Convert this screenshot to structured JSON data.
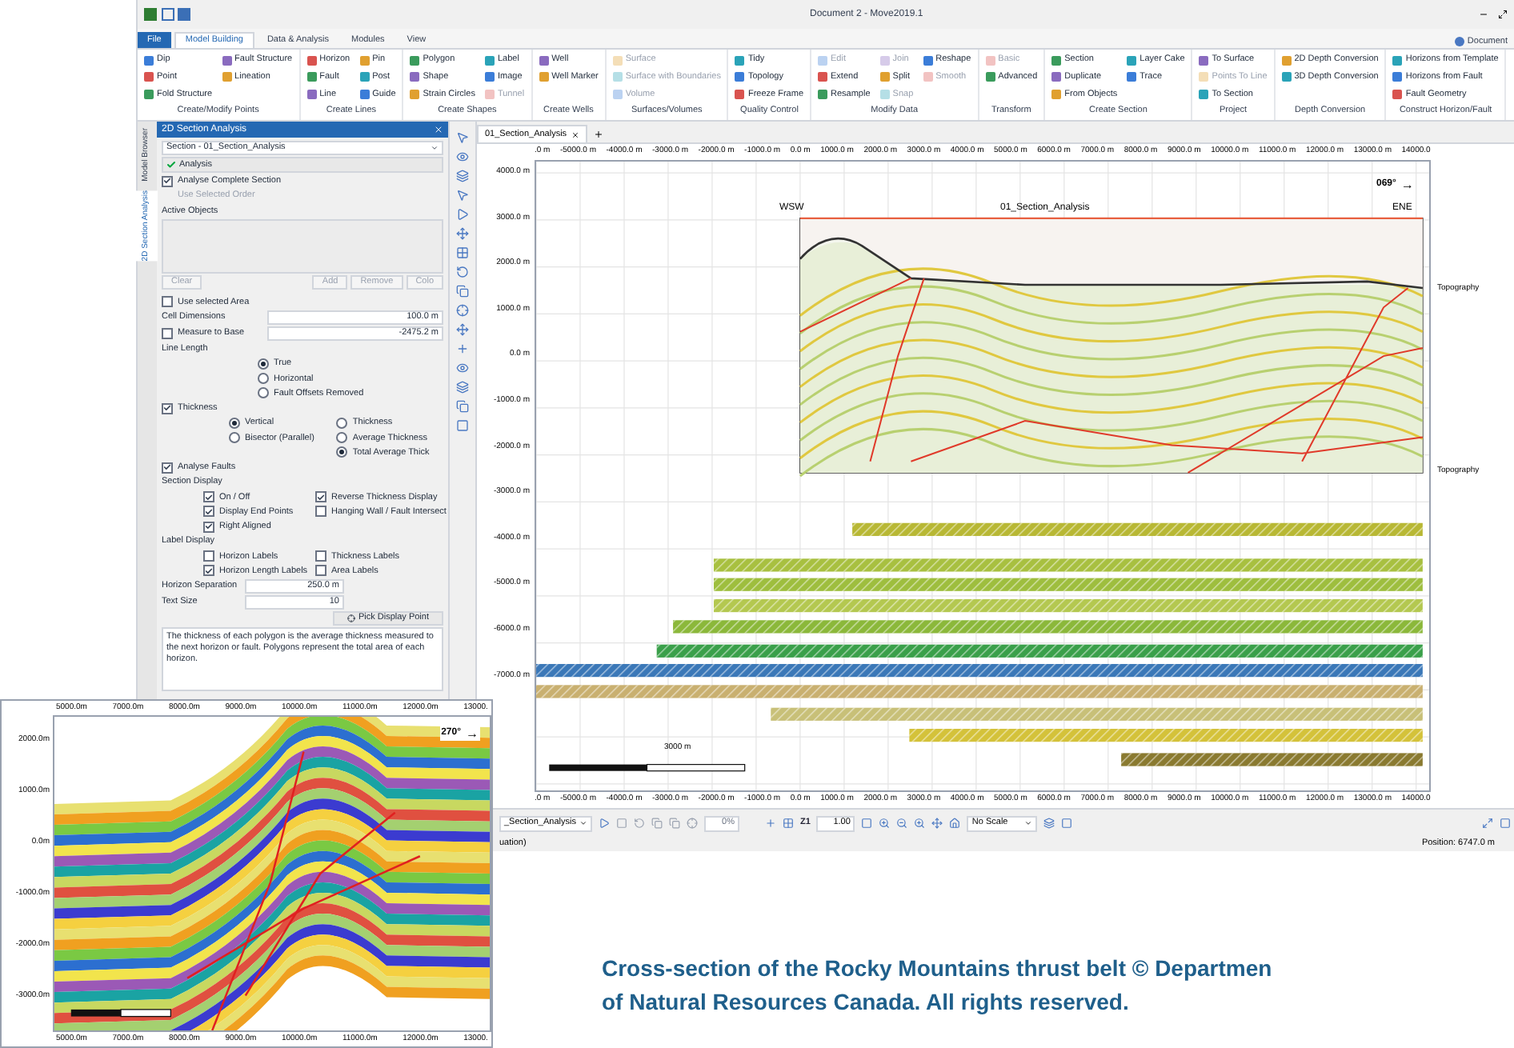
{
  "title_bar": {
    "title": "Document 2 - Move2019.1",
    "account": "Document"
  },
  "ribbon_tabs": [
    {
      "label": "File",
      "kind": "file",
      "selected": false
    },
    {
      "label": "Model Building",
      "kind": "tab",
      "selected": true
    },
    {
      "label": "Data & Analysis",
      "kind": "tab",
      "selected": false
    },
    {
      "label": "Modules",
      "kind": "tab",
      "selected": false
    },
    {
      "label": "View",
      "kind": "tab",
      "selected": false
    }
  ],
  "ribbon_groups": [
    {
      "label": "Create/Modify Points",
      "items": [
        {
          "label": "Dip",
          "disabled": false
        },
        {
          "label": "Point",
          "disabled": false
        },
        {
          "label": "Fold Structure",
          "disabled": false
        },
        {
          "label": "Fault Structure",
          "disabled": false
        },
        {
          "label": "Lineation",
          "disabled": false
        }
      ]
    },
    {
      "label": "Create Lines",
      "items": [
        {
          "label": "Horizon",
          "disabled": false
        },
        {
          "label": "Fault",
          "disabled": false
        },
        {
          "label": "Line",
          "disabled": false
        },
        {
          "label": "Pin",
          "disabled": false
        },
        {
          "label": "Post",
          "disabled": false
        },
        {
          "label": "Guide",
          "disabled": false
        }
      ]
    },
    {
      "label": "Create Shapes",
      "items": [
        {
          "label": "Polygon",
          "disabled": false
        },
        {
          "label": "Shape",
          "disabled": false
        },
        {
          "label": "Strain Circles",
          "disabled": false
        },
        {
          "label": "Label",
          "disabled": false
        },
        {
          "label": "Image",
          "disabled": false
        },
        {
          "label": "Tunnel",
          "disabled": true
        }
      ]
    },
    {
      "label": "Create Wells",
      "items": [
        {
          "label": "Well",
          "disabled": false
        },
        {
          "label": "Well Marker",
          "disabled": false
        }
      ]
    },
    {
      "label": "Surfaces/Volumes",
      "items": [
        {
          "label": "Surface",
          "disabled": true
        },
        {
          "label": "Surface with Boundaries",
          "disabled": true
        },
        {
          "label": "Volume",
          "disabled": true
        }
      ]
    },
    {
      "label": "Quality Control",
      "items": [
        {
          "label": "Tidy",
          "disabled": false
        },
        {
          "label": "Topology",
          "disabled": false
        },
        {
          "label": "Freeze Frame",
          "disabled": false
        }
      ]
    },
    {
      "label": "Modify Data",
      "items": [
        {
          "label": "Edit",
          "disabled": true
        },
        {
          "label": "Extend",
          "disabled": false
        },
        {
          "label": "Resample",
          "disabled": false
        },
        {
          "label": "Join",
          "disabled": true
        },
        {
          "label": "Split",
          "disabled": false
        },
        {
          "label": "Snap",
          "disabled": true
        },
        {
          "label": "Reshape",
          "disabled": false
        },
        {
          "label": "Smooth",
          "disabled": true
        }
      ]
    },
    {
      "label": "Transform",
      "items": [
        {
          "label": "Basic",
          "disabled": true
        },
        {
          "label": "Advanced",
          "disabled": false
        }
      ]
    },
    {
      "label": "Create Section",
      "items": [
        {
          "label": "Section",
          "disabled": false
        },
        {
          "label": "Duplicate",
          "disabled": false
        },
        {
          "label": "From Objects",
          "disabled": false
        },
        {
          "label": "Layer Cake",
          "disabled": false
        },
        {
          "label": "Trace",
          "disabled": false
        }
      ]
    },
    {
      "label": "Project",
      "items": [
        {
          "label": "To Surface",
          "disabled": false
        },
        {
          "label": "Points To Line",
          "disabled": true
        },
        {
          "label": "To Section",
          "disabled": false
        }
      ]
    },
    {
      "label": "Depth Conversion",
      "items": [
        {
          "label": "2D Depth Conversion",
          "disabled": false
        },
        {
          "label": "3D Depth Conversion",
          "disabled": false
        }
      ]
    },
    {
      "label": "Construct Horizon/Fault",
      "items": [
        {
          "label": "Horizons from Template",
          "disabled": false
        },
        {
          "label": "Horizons from Fault",
          "disabled": false
        },
        {
          "label": "Fault Geometry",
          "disabled": false
        }
      ]
    }
  ],
  "side_tabs": [
    {
      "label": "Model Browser",
      "selected": false
    },
    {
      "label": "2D Section Analysis",
      "selected": true
    }
  ],
  "panel": {
    "title": "2D Section Analysis",
    "section_select": "Section - 01_Section_Analysis",
    "analysis_button": "Analysis",
    "analyse_complete": {
      "label": "Analyse Complete Section",
      "checked": true
    },
    "use_selected_order": {
      "label": "Use Selected Order",
      "disabled": true
    },
    "active_objects": {
      "label": "Active Objects",
      "buttons": [
        {
          "label": "Clear",
          "disabled": true
        },
        {
          "label": "Add",
          "disabled": true
        },
        {
          "label": "Remove",
          "disabled": true
        },
        {
          "label": "Colo",
          "disabled": true
        }
      ]
    },
    "use_selected_area": {
      "label": "Use selected Area",
      "checked": false
    },
    "cell_dimensions": {
      "label": "Cell Dimensions",
      "value": "100.0 m"
    },
    "measure_to_base": {
      "label": "Measure to Base",
      "checked": false,
      "value": "-2475.2 m"
    },
    "line_length": {
      "label": "Line Length",
      "options": [
        {
          "label": "True",
          "selected": true
        },
        {
          "label": "Horizontal",
          "selected": false
        },
        {
          "label": "Fault Offsets Removed",
          "selected": false
        }
      ]
    },
    "thickness": {
      "label": "Thickness",
      "checked": true,
      "direction": [
        {
          "label": "Vertical",
          "selected": true
        },
        {
          "label": "Bisector (Parallel)",
          "selected": false
        }
      ],
      "measure": [
        {
          "label": "Thickness",
          "selected": false
        },
        {
          "label": "Average Thickness",
          "selected": false
        },
        {
          "label": "Total Average Thick",
          "selected": true
        }
      ]
    },
    "analyse_faults": {
      "label": "Analyse Faults",
      "checked": true
    },
    "section_display": {
      "label": "Section Display",
      "options": [
        {
          "label": "On / Off",
          "checked": true
        },
        {
          "label": "Reverse Thickness Display",
          "checked": true
        },
        {
          "label": "Display End Points",
          "checked": true
        },
        {
          "label": "Hanging Wall / Fault Intersect",
          "checked": false
        },
        {
          "label": "Right Aligned",
          "checked": true
        }
      ]
    },
    "label_display": {
      "label": "Label Display",
      "options": [
        {
          "label": "Horizon Labels",
          "checked": false
        },
        {
          "label": "Thickness Labels",
          "checked": false
        },
        {
          "label": "Horizon Length Labels",
          "checked": true
        },
        {
          "label": "Area Labels",
          "checked": false
        }
      ]
    },
    "horizon_separation": {
      "label": "Horizon Separation",
      "value": "250.0 m"
    },
    "text_size": {
      "label": "Text Size",
      "value": "10"
    },
    "pick_button": "Pick Display Point",
    "description": "The thickness of each polygon is the average thickness measured to the next horizon or fault. Polygons represent the total area of each horizon."
  },
  "plot": {
    "tab": "01_Section_Analysis",
    "x_labels": [
      ".0 m",
      "-5000.0 m",
      "-4000.0 m",
      "-3000.0 m",
      "-2000.0 m",
      "-1000.0 m",
      "0.0 m",
      "1000.0 m",
      "2000.0 m",
      "3000.0 m",
      "4000.0 m",
      "5000.0 m",
      "6000.0 m",
      "7000.0 m",
      "8000.0 m",
      "9000.0 m",
      "10000.0 m",
      "11000.0 m",
      "12000.0 m",
      "13000.0 m",
      "14000.0"
    ],
    "bottom_x_labels": [
      ".0 m",
      "-5000.0 m",
      "-4000.0 m",
      "-3000.0 m",
      "-2000.0 m",
      "-1000.0 m",
      "0.0 m",
      "1000.0 m",
      "2000.0 m",
      "3000.0 m",
      "4000.0 m",
      "5000.0 m",
      "6000.0 m",
      "7000.0 m",
      "8000.0 m",
      "9000.0 m",
      "10000.0 m",
      "11000.0 m",
      "12000.0 m",
      "13000.0 m",
      "14000.0"
    ],
    "y_labels": [
      "4000.0 m",
      "3000.0 m",
      "2000.0 m",
      "1000.0 m",
      "0.0 m",
      "-1000.0 m",
      "-2000.0 m",
      "-3000.0 m",
      "-4000.0 m",
      "-5000.0 m",
      "-6000.0 m",
      "-7000.0 m"
    ],
    "section_name": "01_Section_Analysis",
    "left_end": "WSW",
    "right_end": "ENE",
    "azimuth": "069°",
    "azimuth_arrow": "→",
    "right_labels": [
      "Topography",
      "Topography"
    ],
    "scale_bar": "3000 m"
  },
  "bottom_toolbar": {
    "section_select": "_Section_Analysis",
    "percent": "0%",
    "z_label": "Z1",
    "zoom": "1.00",
    "scale": "No Scale"
  },
  "status_bar": {
    "left": "uation)",
    "position": "Position: 6747.0 m"
  },
  "inset": {
    "x_labels": [
      "5000.0m",
      "7000.0m",
      "8000.0m",
      "9000.0m",
      "10000.0m",
      "11000.0m",
      "12000.0m",
      "13000."
    ],
    "bottom_x_labels": [
      "5000.0m",
      "7000.0m",
      "8000.0m",
      "9000.0m",
      "10000.0m",
      "11000.0m",
      "12000.0m",
      "13000."
    ],
    "y_labels": [
      "2000.0m",
      "1000.0m",
      "0.0m",
      "-1000.0m",
      "-2000.0m",
      "-3000.0m"
    ],
    "azimuth": "270°",
    "azimuth_arrow": "→"
  },
  "caption_lines": [
    "Cross-section of the Rocky Mountains thrust belt © Departmen",
    "of Natural Resources Canada. All rights reserved."
  ]
}
